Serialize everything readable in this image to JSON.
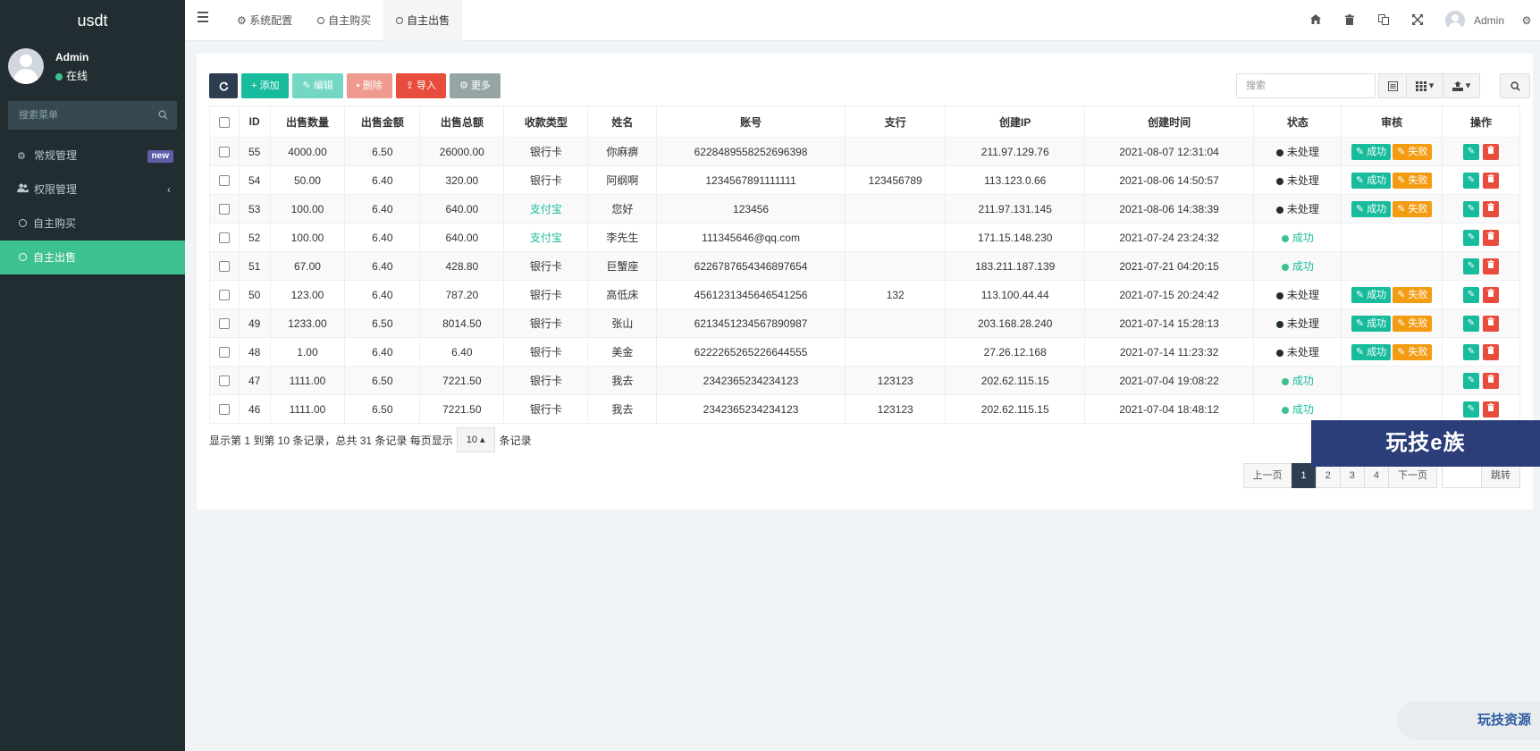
{
  "app": {
    "logo": "usdt"
  },
  "user": {
    "name": "Admin",
    "status": "在线"
  },
  "sidebar": {
    "search_placeholder": "搜索菜单",
    "items": [
      {
        "label": "常规管理",
        "icon": "cogs-icon",
        "badge": "new"
      },
      {
        "label": "权限管理",
        "icon": "users-icon",
        "chevron": "‹"
      },
      {
        "label": "自主购买",
        "icon": "circle-icon"
      },
      {
        "label": "自主出售",
        "icon": "circle-icon",
        "active": true
      }
    ]
  },
  "topbar": {
    "tabs": [
      {
        "label": "系统配置",
        "icon": "gear-icon"
      },
      {
        "label": "自主购买",
        "icon": "circle-icon"
      },
      {
        "label": "自主出售",
        "icon": "circle-icon",
        "active": true
      }
    ],
    "user_name": "Admin"
  },
  "toolbar": {
    "add": "添加",
    "edit": "编辑",
    "delete": "删除",
    "import": "导入",
    "more": "更多",
    "search_placeholder": "搜索"
  },
  "table": {
    "headers": [
      "ID",
      "出售数量",
      "出售金额",
      "出售总额",
      "收款类型",
      "姓名",
      "账号",
      "支行",
      "创建IP",
      "创建时间",
      "状态",
      "审核",
      "操作"
    ],
    "rows": [
      {
        "id": "55",
        "qty": "4000.00",
        "price": "6.50",
        "total": "26000.00",
        "paytype": "银行卡",
        "name": "你麻痹",
        "account": "6228489558252696398",
        "branch": "",
        "ip": "211.97.129.76",
        "time": "2021-08-07 12:31:04",
        "status": "未处理"
      },
      {
        "id": "54",
        "qty": "50.00",
        "price": "6.40",
        "total": "320.00",
        "paytype": "银行卡",
        "name": "阿纲啊",
        "account": "1234567891111111",
        "branch": "123456789",
        "ip": "113.123.0.66",
        "time": "2021-08-06 14:50:57",
        "status": "未处理"
      },
      {
        "id": "53",
        "qty": "100.00",
        "price": "6.40",
        "total": "640.00",
        "paytype": "支付宝",
        "name": "您好",
        "account": "123456",
        "branch": "",
        "ip": "211.97.131.145",
        "time": "2021-08-06 14:38:39",
        "status": "未处理"
      },
      {
        "id": "52",
        "qty": "100.00",
        "price": "6.40",
        "total": "640.00",
        "paytype": "支付宝",
        "name": "李先生",
        "account": "111345646@qq.com",
        "branch": "",
        "ip": "171.15.148.230",
        "time": "2021-07-24 23:24:32",
        "status": "成功"
      },
      {
        "id": "51",
        "qty": "67.00",
        "price": "6.40",
        "total": "428.80",
        "paytype": "银行卡",
        "name": "巨蟹座",
        "account": "6226787654346897654",
        "branch": "",
        "ip": "183.211.187.139",
        "time": "2021-07-21 04:20:15",
        "status": "成功"
      },
      {
        "id": "50",
        "qty": "123.00",
        "price": "6.40",
        "total": "787.20",
        "paytype": "银行卡",
        "name": "高低床",
        "account": "4561231345646541256",
        "branch": "132",
        "ip": "113.100.44.44",
        "time": "2021-07-15 20:24:42",
        "status": "未处理"
      },
      {
        "id": "49",
        "qty": "1233.00",
        "price": "6.50",
        "total": "8014.50",
        "paytype": "银行卡",
        "name": "张山",
        "account": "6213451234567890987",
        "branch": "",
        "ip": "203.168.28.240",
        "time": "2021-07-14 15:28:13",
        "status": "未处理"
      },
      {
        "id": "48",
        "qty": "1.00",
        "price": "6.40",
        "total": "6.40",
        "paytype": "银行卡",
        "name": "美金",
        "account": "6222265265226644555",
        "branch": "",
        "ip": "27.26.12.168",
        "time": "2021-07-14 11:23:32",
        "status": "未处理"
      },
      {
        "id": "47",
        "qty": "1111.00",
        "price": "6.50",
        "total": "7221.50",
        "paytype": "银行卡",
        "name": "我去",
        "account": "2342365234234123",
        "branch": "123123",
        "ip": "202.62.115.15",
        "time": "2021-07-04 19:08:22",
        "status": "成功"
      },
      {
        "id": "46",
        "qty": "1111.00",
        "price": "6.50",
        "total": "7221.50",
        "paytype": "银行卡",
        "name": "我去",
        "account": "2342365234234123",
        "branch": "123123",
        "ip": "202.62.115.15",
        "time": "2021-07-04 18:48:12",
        "status": "成功"
      }
    ],
    "audit_ok": "成功",
    "audit_fail": "失败"
  },
  "footer": {
    "info": "显示第 1 到第 10 条记录，总共 31 条记录 每页显示",
    "page_size": "10",
    "suffix": "条记录"
  },
  "pager": {
    "prev": "上一页",
    "pages": [
      "1",
      "2",
      "3",
      "4"
    ],
    "next": "下一页",
    "jump": "跳转"
  },
  "watermarks": {
    "banner": "玩技e族",
    "corner": "玩技资源"
  },
  "colors": {
    "sidebar": "#222d32",
    "accent": "#18bc9c",
    "active_menu": "#3ec190",
    "danger": "#e74c3c",
    "warning": "#f39c12",
    "dark_button": "#2c3e50"
  }
}
